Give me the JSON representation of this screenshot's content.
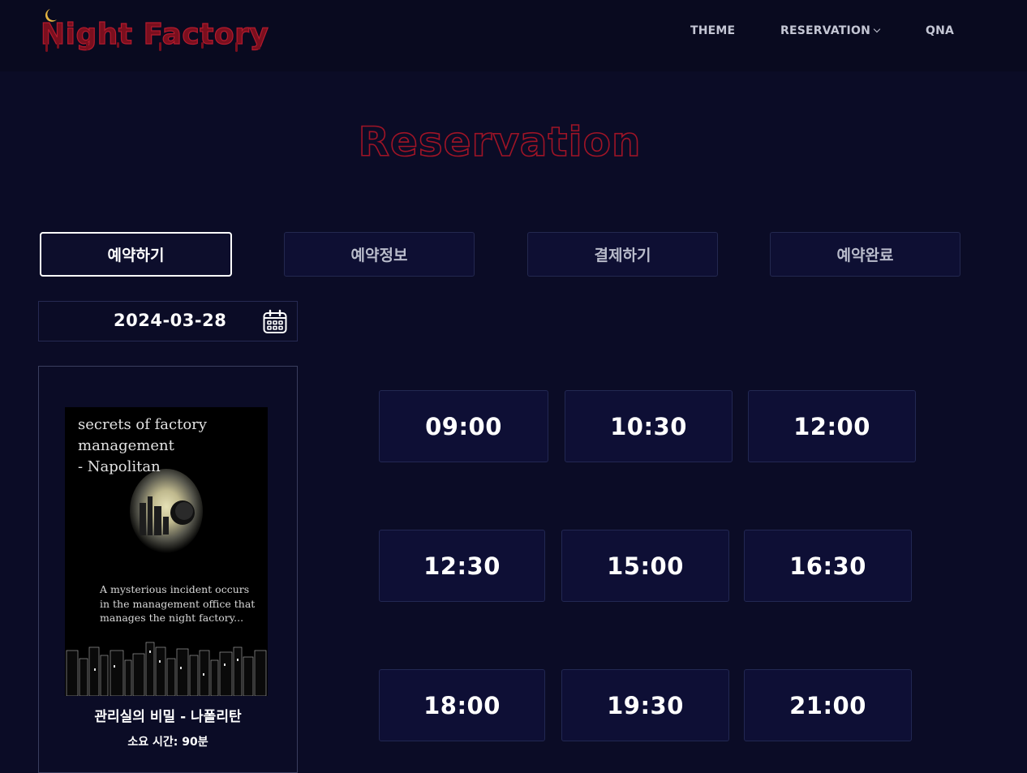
{
  "header": {
    "logo_text": "Night Factory",
    "nav": {
      "theme": "THEME",
      "reservation": "RESERVATION",
      "qna": "QNA"
    }
  },
  "page": {
    "title": "Reservation"
  },
  "steps": [
    {
      "label": "예약하기",
      "active": true
    },
    {
      "label": "예약정보",
      "active": false
    },
    {
      "label": "결제하기",
      "active": false
    },
    {
      "label": "예약완료",
      "active": false
    }
  ],
  "date_picker": {
    "value": "2024-03-28",
    "icon": "calendar-icon"
  },
  "theme": {
    "poster": {
      "title": "secrets of factory\nmanagement\n - Napolitan",
      "description": "A mysterious incident occurs in the management office that manages the night factory..."
    },
    "name": "관리실의 비밀 - 나폴리탄",
    "duration": "소요 시간: 90분"
  },
  "time_slots": [
    "09:00",
    "10:30",
    "12:00",
    "12:30",
    "15:00",
    "16:30",
    "18:00",
    "19:30",
    "21:00"
  ],
  "colors": {
    "background": "#0b0c26",
    "header_bg": "#090a1f",
    "accent_red": "#7a0f1e",
    "moon": "#e3b341",
    "slot_bg": "#0e0f35"
  }
}
